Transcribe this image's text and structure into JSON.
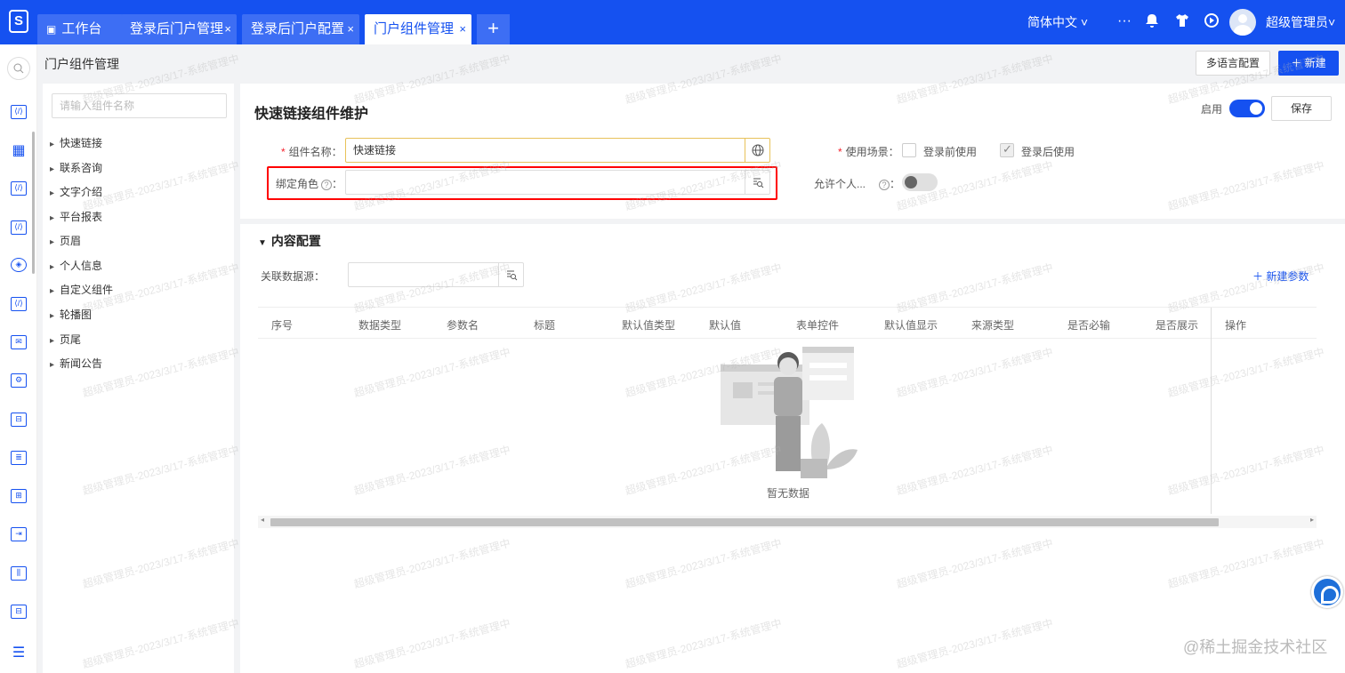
{
  "topbar": {
    "tabs": [
      {
        "label": "工作台"
      },
      {
        "label": "登录后门户管理"
      },
      {
        "label": "登录后门户配置"
      },
      {
        "label": "门户组件管理"
      }
    ],
    "tab_close": "×",
    "tab_add": "+",
    "language": "简体中文 ˅",
    "more": "···",
    "user_name": "超级管理员˅"
  },
  "header": {
    "page_title": "门户组件管理",
    "multilang_button": "多语言配置",
    "new_button": "＋ 新建"
  },
  "tree": {
    "search_placeholder": "请输入组件名称",
    "items": [
      "快速链接",
      "联系咨询",
      "文字介绍",
      "平台报表",
      "页眉",
      "个人信息",
      "自定义组件",
      "轮播图",
      "页尾",
      "新闻公告"
    ]
  },
  "form": {
    "title": "快速链接组件维护",
    "enable_label": "启用",
    "save_button": "保存",
    "name_label": "组件名称：",
    "name_value": "快速链接",
    "role_label": "绑定角色",
    "role_colon": "：",
    "scene_label": "使用场景：",
    "scene_before": "登录前使用",
    "scene_after": "登录后使用",
    "allow_personal_label": "允许个人...",
    "allow_colon": "：",
    "required_mark": "*",
    "help_mark": "?"
  },
  "content_config": {
    "title": "内容配置",
    "datasource_label": "关联数据源：",
    "new_param_button": "＋ 新建参数",
    "columns": [
      "序号",
      "数据类型",
      "参数名",
      "标题",
      "默认值类型",
      "默认值",
      "表单控件",
      "默认值显示",
      "来源类型",
      "是否必输",
      "是否展示",
      "操作"
    ],
    "empty_text": "暂无数据"
  },
  "watermark_text": "超级管理员-2023/3/17-系统管理中",
  "footer_mark": "@稀土掘金技术社区",
  "colors": {
    "primary": "#1551f0",
    "required": "#f5222d",
    "highlight_border": "#ff0000"
  }
}
